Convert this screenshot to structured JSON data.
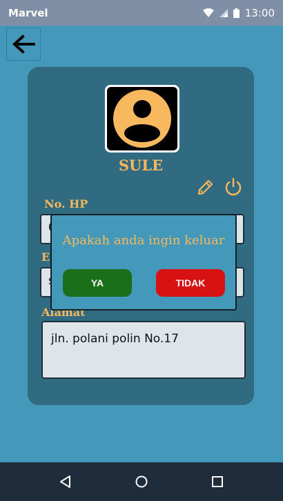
{
  "status_bar": {
    "carrier": "Marvel",
    "time": "13:00",
    "icons": [
      "wifi-icon",
      "signal-icon",
      "battery-icon"
    ]
  },
  "header": {
    "back_icon": "arrow-left-icon"
  },
  "profile": {
    "avatar_icon": "user-avatar-icon",
    "name": "SULE",
    "edit_icon": "pencil-icon",
    "logout_icon": "power-icon",
    "fields": {
      "phone_label": "No. HP",
      "phone_value": "0",
      "email_label": "E-",
      "email_value": "s",
      "address_label": "Alamat",
      "address_value": "jln. polani polin No.17"
    }
  },
  "dialog": {
    "title": "Apakah anda ingin keluar",
    "confirm_label": "YA",
    "cancel_label": "TIDAK"
  },
  "nav_bar": {
    "icons": [
      "back-triangle-icon",
      "home-circle-icon",
      "recents-square-icon"
    ]
  },
  "colors": {
    "background": "#4499ba",
    "card": "#316b81",
    "accent": "#f7b85e",
    "confirm": "#1b6e1a",
    "cancel": "#d81212",
    "nav_bar": "#1f2c3b",
    "status_bar": "#7f8fa6"
  }
}
